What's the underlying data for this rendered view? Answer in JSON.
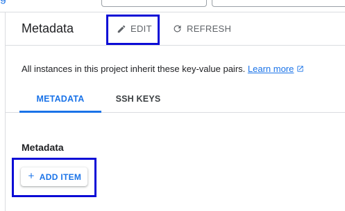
{
  "header": {
    "title": "Metadata",
    "edit_label": "EDIT",
    "refresh_label": "REFRESH"
  },
  "info": {
    "text": "All instances in this project inherit these key-value pairs.",
    "learn_more": "Learn more"
  },
  "tabs": [
    {
      "label": "METADATA",
      "active": true
    },
    {
      "label": "SSH KEYS",
      "active": false
    }
  ],
  "section": {
    "title": "Metadata",
    "add_item_label": "ADD ITEM"
  },
  "icons": {
    "edit": "pencil-icon",
    "refresh": "refresh-icon",
    "external": "open-in-new-icon",
    "add": "plus-icon"
  },
  "colors": {
    "accent": "#1a73e8",
    "highlight": "#0b0bd6",
    "text": "#202124",
    "muted": "#5f6368"
  }
}
